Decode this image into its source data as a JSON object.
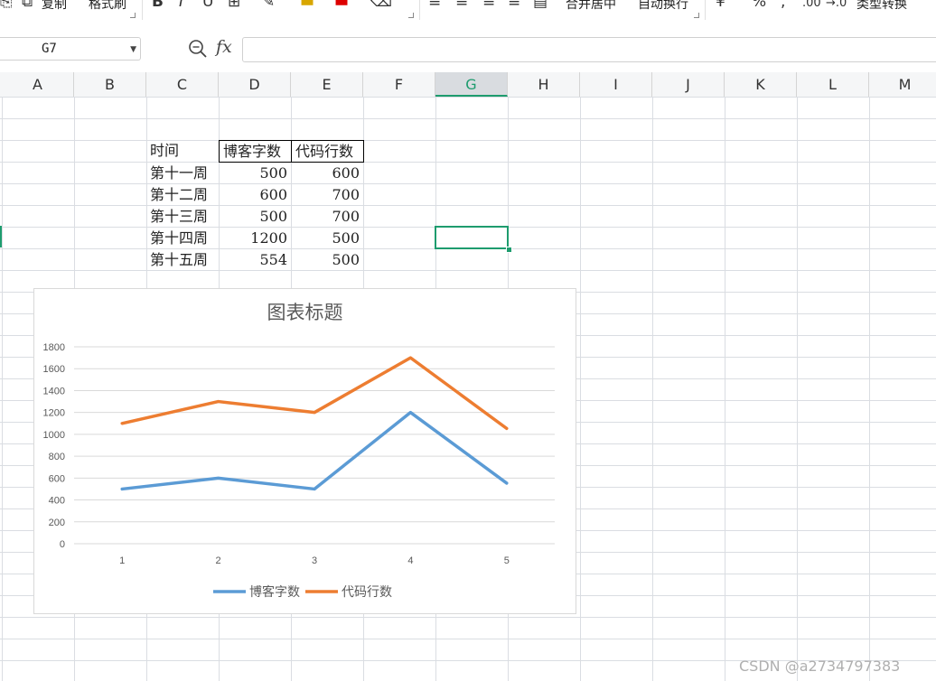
{
  "ribbon": {
    "copy_label": "复制",
    "format_painter_label": "格式刷",
    "merge_label": "合并居中",
    "wrap_label": "自动换行",
    "convert_label": "类型转换"
  },
  "formula_bar": {
    "cell_ref": "G7",
    "fx_symbol": "fx",
    "formula_value": ""
  },
  "columns": [
    "A",
    "B",
    "C",
    "D",
    "E",
    "F",
    "G",
    "H",
    "I",
    "J",
    "K",
    "L",
    "M"
  ],
  "selected_column": "G",
  "table": {
    "headers": [
      "时间",
      "博客字数",
      "代码行数"
    ],
    "rows": [
      [
        "第十一周",
        "500",
        "600"
      ],
      [
        "第十二周",
        "600",
        "700"
      ],
      [
        "第十三周",
        "500",
        "700"
      ],
      [
        "第十四周",
        "1200",
        "500"
      ],
      [
        "第十五周",
        "554",
        "500"
      ]
    ]
  },
  "chart_data": {
    "type": "line",
    "title": "图表标题",
    "x": [
      "1",
      "2",
      "3",
      "4",
      "5"
    ],
    "ylim": [
      0,
      1800
    ],
    "yticks": [
      "0",
      "200",
      "400",
      "600",
      "800",
      "1000",
      "1200",
      "1400",
      "1600",
      "1800"
    ],
    "stacked": true,
    "series": [
      {
        "name": "博客字数",
        "color": "#5b9bd5",
        "values": [
          500,
          600,
          500,
          1200,
          554
        ]
      },
      {
        "name": "代码行数",
        "color": "#ed7d31",
        "values": [
          600,
          700,
          700,
          500,
          500
        ]
      }
    ],
    "legend_position": "bottom",
    "grid": true
  },
  "watermark": "CSDN @a2734797383"
}
